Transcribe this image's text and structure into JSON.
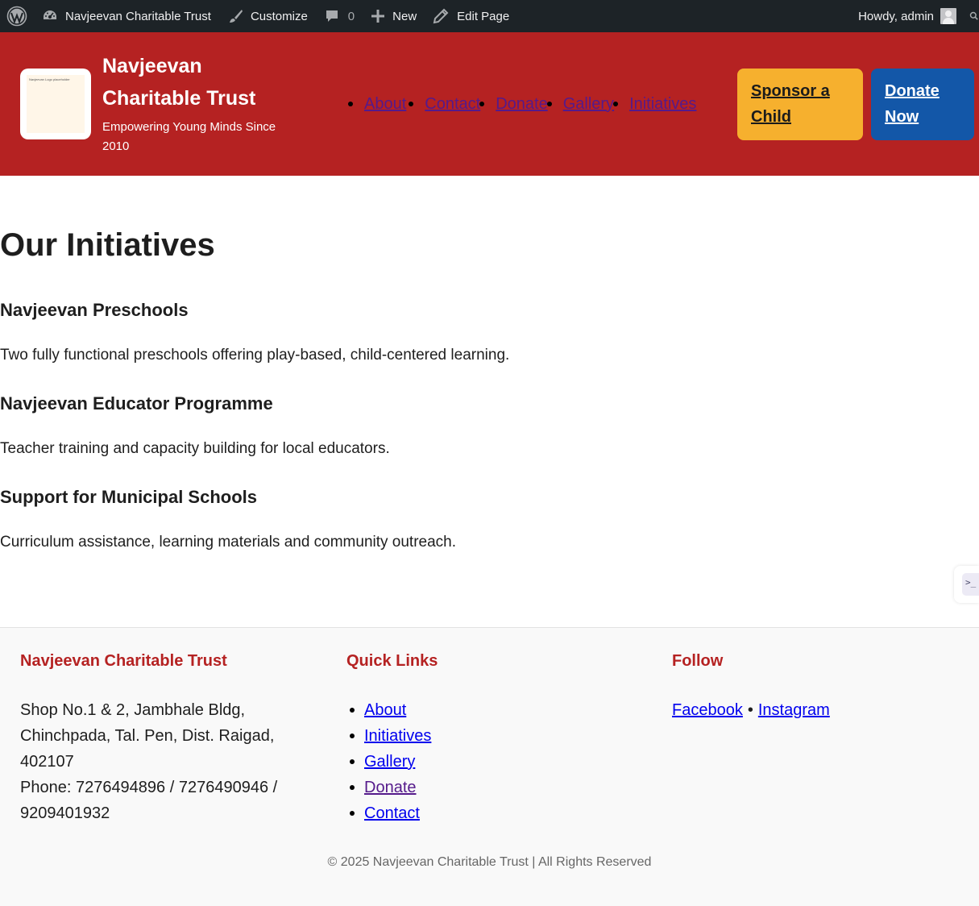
{
  "admin_bar": {
    "site_name": "Navjeevan Charitable Trust",
    "customize": "Customize",
    "comments_count": "0",
    "new": "New",
    "edit_page": "Edit Page",
    "howdy": "Howdy, admin"
  },
  "header": {
    "logo_text": "Navjeevan Logo placeholder",
    "title": "Navjeevan Charitable Trust",
    "tagline": "Empowering Young Minds Since 2010",
    "nav": [
      "About",
      "Contact",
      "Donate",
      "Gallery",
      "Initiatives"
    ],
    "sponsor_button": "Sponsor a Child",
    "donate_button": "Donate Now"
  },
  "main": {
    "page_title": "Our Initiatives",
    "initiatives": [
      {
        "title": "Navjeevan Preschools",
        "description": "Two fully functional preschools offering play-based, child-centered learning."
      },
      {
        "title": "Navjeevan Educator Programme",
        "description": "Teacher training and capacity building for local educators."
      },
      {
        "title": "Support for Municipal Schools",
        "description": "Curriculum assistance, learning materials and community outreach."
      }
    ],
    "side_widget": ">_"
  },
  "footer": {
    "org_heading": "Navjeevan Charitable Trust",
    "address_lines": [
      "Shop No.1 & 2, Jambhale Bldg,",
      "Chinchpada, Tal. Pen, Dist. Raigad,",
      "402107",
      "Phone: 7276494896 / 7276490946 /",
      "9209401932"
    ],
    "links_heading": "Quick Links",
    "links": [
      "About",
      "Initiatives",
      "Gallery",
      "Donate",
      "Contact"
    ],
    "follow_heading": "Follow",
    "social": [
      "Facebook",
      "Instagram"
    ],
    "social_separator": "•",
    "copyright": "© 2025 Navjeevan Charitable Trust | All Rights Reserved"
  },
  "colors": {
    "admin_bar": "#1d2327",
    "header_bg": "#b52222",
    "sponsor_bg": "#f6b02e",
    "donate_bg": "#1357a8",
    "footer_bg": "#f9f9f9",
    "footer_heading": "#b52222"
  }
}
